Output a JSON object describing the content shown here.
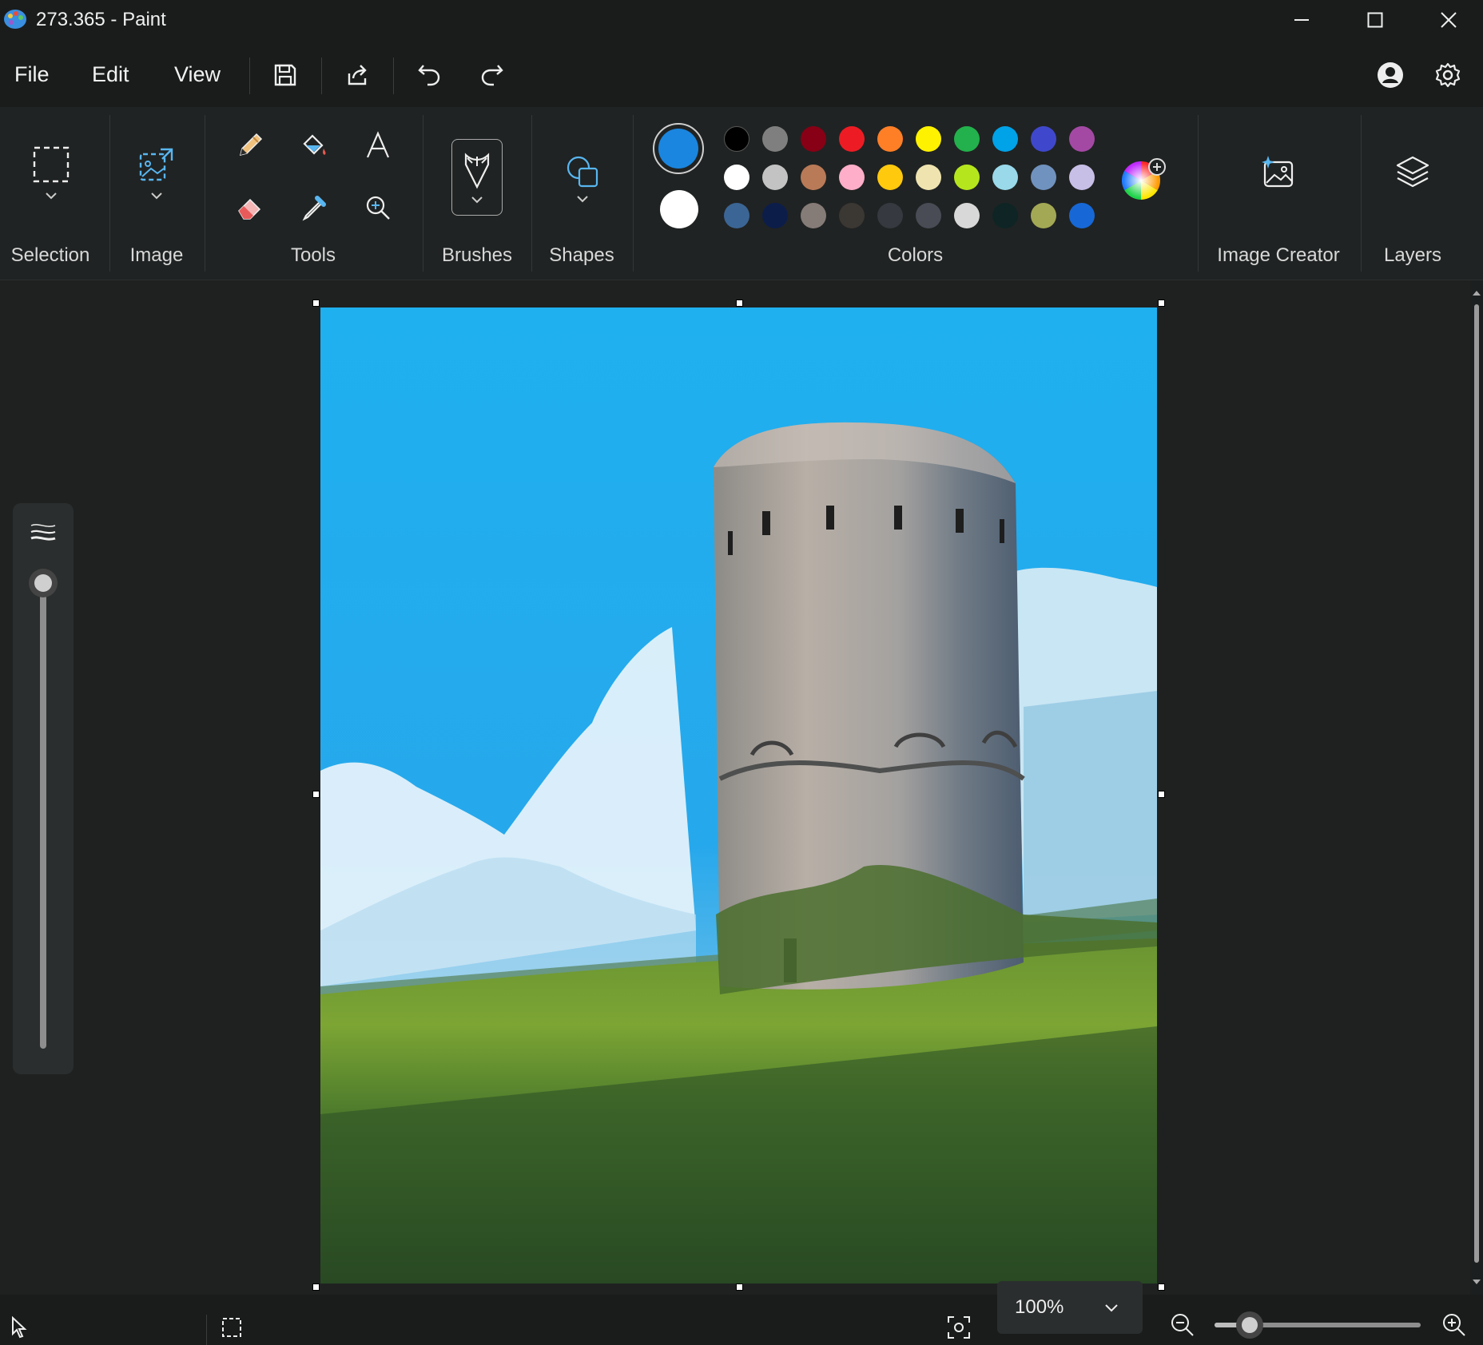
{
  "window": {
    "title": "273.365 - Paint"
  },
  "menu": {
    "file": "File",
    "edit": "Edit",
    "view": "View"
  },
  "ribbon": {
    "selection": "Selection",
    "image": "Image",
    "tools": "Tools",
    "brushes": "Brushes",
    "shapes": "Shapes",
    "colors": "Colors",
    "image_creator": "Image Creator",
    "layers": "Layers"
  },
  "colors": {
    "primary": "#1a86e0",
    "secondary": "#ffffff",
    "palette": [
      [
        "#000000",
        "#7f7f7f",
        "#880015",
        "#ed1c24",
        "#ff7f27",
        "#fff200",
        "#22b14c",
        "#00a2e8",
        "#3f48cc",
        "#a349a4"
      ],
      [
        "#ffffff",
        "#c3c3c3",
        "#b97a57",
        "#ffaec9",
        "#ffc90e",
        "#efe4b0",
        "#b5e61d",
        "#99d9ea",
        "#7092be",
        "#c8bfe7"
      ],
      [
        "#3b6594",
        "#0c1d4a",
        "#857b77",
        "#3b3733",
        "#36393f",
        "#494c55",
        "#d8d8d8",
        "#0f2424",
        "#a3a855",
        "#1768d6"
      ]
    ]
  },
  "status": {
    "zoom": "100%",
    "zoom_level": 0.17
  }
}
